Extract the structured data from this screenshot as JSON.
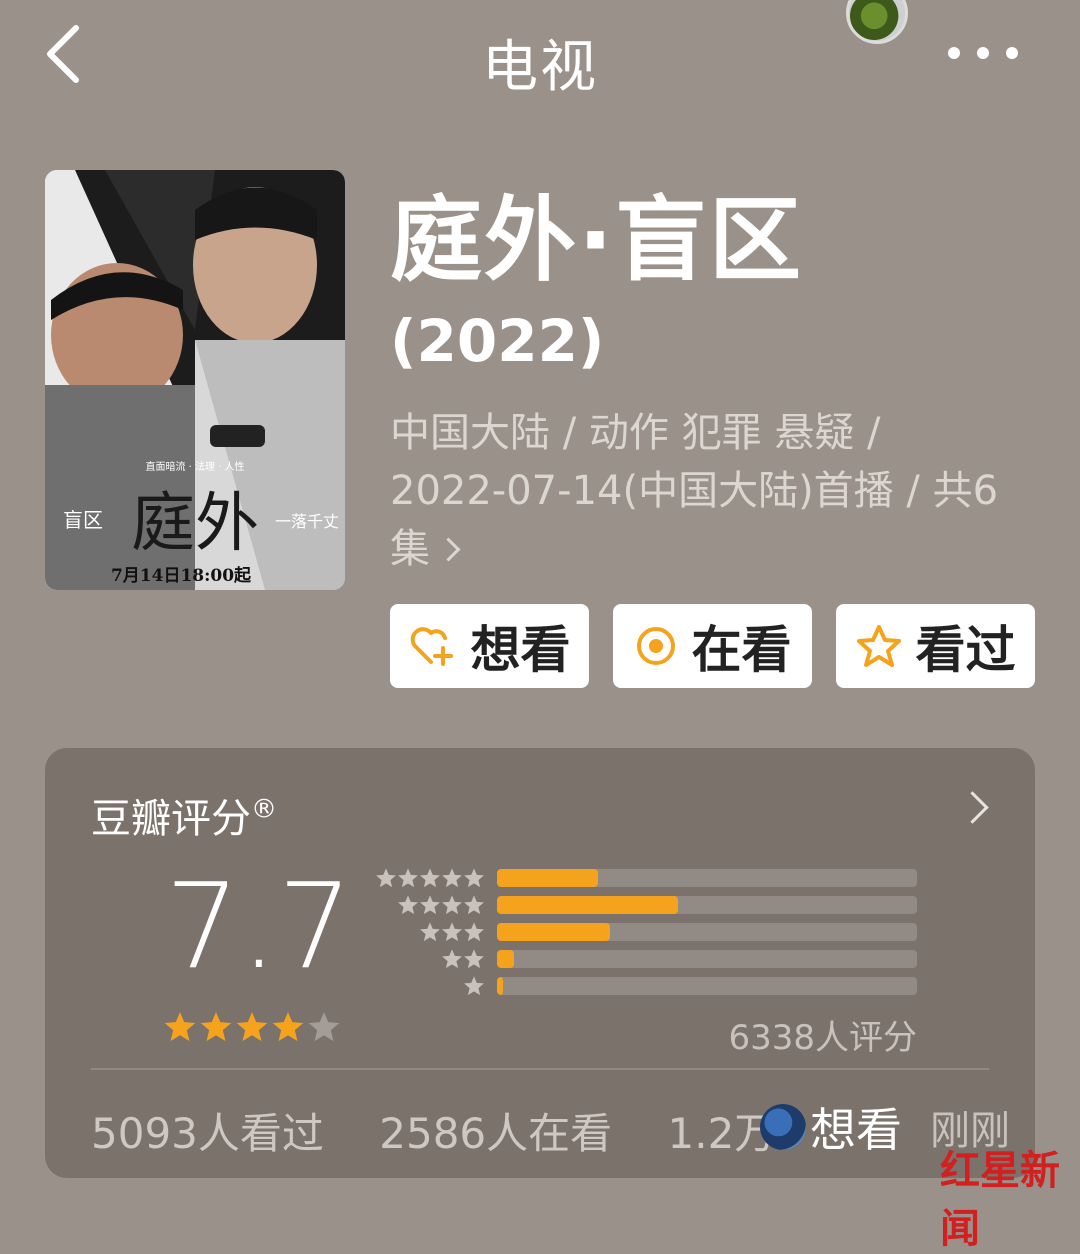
{
  "header": {
    "title": "电视"
  },
  "poster": {
    "title_text": "庭外",
    "subtitle": "盲区",
    "date": "7月14日18:00起",
    "tagline": "直面暗流 · 法理 · 人性",
    "brand": "一落千丈"
  },
  "show": {
    "title": "庭外·盲区",
    "year": "(2022)",
    "meta_line1": "中国大陆 / 动作 犯罪 悬疑 /",
    "meta_line2": "2022-07-14(中国大陆)首播 / 共6",
    "meta_line3": "集"
  },
  "actions": [
    {
      "label": "想看",
      "icon": "heart-plus-icon"
    },
    {
      "label": "在看",
      "icon": "target-icon"
    },
    {
      "label": "看过",
      "icon": "star-icon"
    }
  ],
  "rating": {
    "title": "豆瓣评分",
    "reg": "®",
    "score": "7.7",
    "stars_filled": 4,
    "stars_total": 5,
    "count_text": "6338人评分",
    "distribution": [
      {
        "stars": 5,
        "percent": 24
      },
      {
        "stars": 4,
        "percent": 43
      },
      {
        "stars": 3,
        "percent": 27
      },
      {
        "stars": 2,
        "percent": 4
      },
      {
        "stars": 1,
        "percent": 1.5
      }
    ],
    "stats": [
      "5093人看过",
      "2586人在看",
      "1.2万"
    ],
    "toast_text": "想看",
    "toast_time": "刚刚"
  },
  "watermark": "红星新闻",
  "colors": {
    "bg": "#9a918a",
    "card": "#7b726c",
    "accent": "#f5a31c"
  }
}
